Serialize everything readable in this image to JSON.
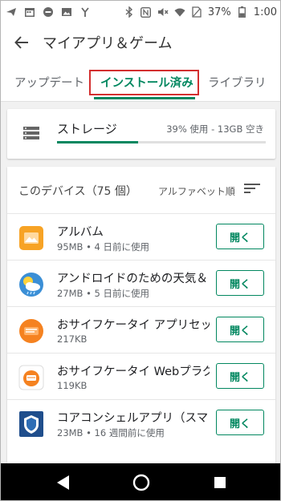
{
  "status_bar": {
    "battery": "37%",
    "time": "1:00"
  },
  "app_bar": {
    "title": "マイアプリ＆ゲーム"
  },
  "tabs": [
    {
      "label": "アップデート",
      "active": false
    },
    {
      "label": "インストール済み",
      "active": true
    },
    {
      "label": "ライブラリ",
      "active": false
    }
  ],
  "storage": {
    "title": "ストレージ",
    "info": "39% 使用 - 13GB 空き",
    "used_fraction": 0.39
  },
  "list": {
    "device_label": "このデバイス（75 個）",
    "sort_label": "アルファベット順",
    "open_label": "開く",
    "apps": [
      {
        "name": "アルバム",
        "meta": "95MB • 4 日前に使用",
        "icon": "album-icon"
      },
      {
        "name": "アンドロイドのための天気＆ｌ",
        "meta": "27MB • 5 日前に使用",
        "icon": "weather-icon"
      },
      {
        "name": "おサイフケータイ アプリセッ",
        "meta": "217KB",
        "icon": "osaifu-setup-icon"
      },
      {
        "name": "おサイフケータイ Webプラグ",
        "meta": "119KB",
        "icon": "osaifu-web-icon"
      },
      {
        "name": "コアコンシェルアプリ（スマ",
        "meta": "23MB • 16 週間前に使用",
        "icon": "core-concier-icon"
      }
    ]
  },
  "colors": {
    "accent": "#01875f",
    "highlight_box": "#d32f2f",
    "navbar": "#000000"
  }
}
